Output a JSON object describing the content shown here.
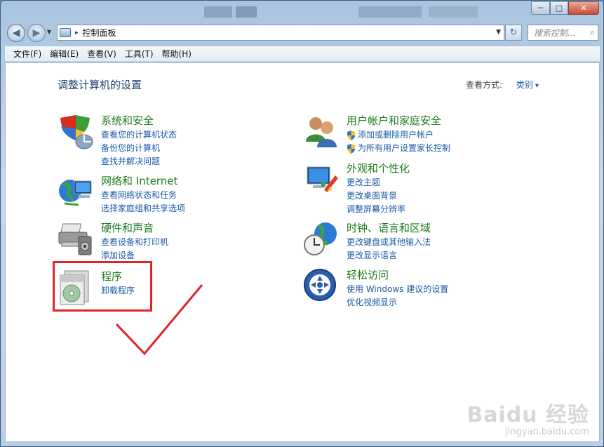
{
  "window": {
    "controls": {
      "minimize": "─",
      "maximize": "□",
      "close": "✕"
    }
  },
  "addressbar": {
    "back_icon": "◀",
    "forward_icon": "▶",
    "separator": "▸",
    "path": "控制面板",
    "refresh_icon": "↻",
    "search_placeholder": "搜索控制...",
    "search_icon": "⌕"
  },
  "menubar": {
    "items": [
      "文件(F)",
      "编辑(E)",
      "查看(V)",
      "工具(T)",
      "帮助(H)"
    ]
  },
  "main": {
    "title": "调整计算机的设置",
    "viewby_label": "查看方式:",
    "viewby_value": "类别",
    "categories": [
      {
        "title": "系统和安全",
        "links": [
          "查看您的计算机状态",
          "备份您的计算机",
          "查找并解决问题"
        ]
      },
      {
        "title": "网络和 Internet",
        "links": [
          "查看网络状态和任务",
          "选择家庭组和共享选项"
        ]
      },
      {
        "title": "硬件和声音",
        "links": [
          "查看设备和打印机",
          "添加设备"
        ]
      },
      {
        "title": "程序",
        "links": [
          "卸载程序"
        ]
      },
      {
        "title": "用户帐户和家庭安全",
        "links": [
          "添加或删除用户帐户",
          "为所有用户设置家长控制"
        ]
      },
      {
        "title": "外观和个性化",
        "links": [
          "更改主题",
          "更改桌面背景",
          "调整屏幕分辨率"
        ]
      },
      {
        "title": "时钟、语言和区域",
        "links": [
          "更改键盘或其他输入法",
          "更改显示语言"
        ]
      },
      {
        "title": "轻松访问",
        "links": [
          "使用 Windows 建议的设置",
          "优化视频显示"
        ]
      }
    ]
  },
  "watermark": {
    "main": "Baidu 经验",
    "sub": "jingyan.baidu.com"
  },
  "colors": {
    "category_title": "#1e7a1e",
    "link": "#1a5aa8",
    "highlight": "#e0232c"
  }
}
